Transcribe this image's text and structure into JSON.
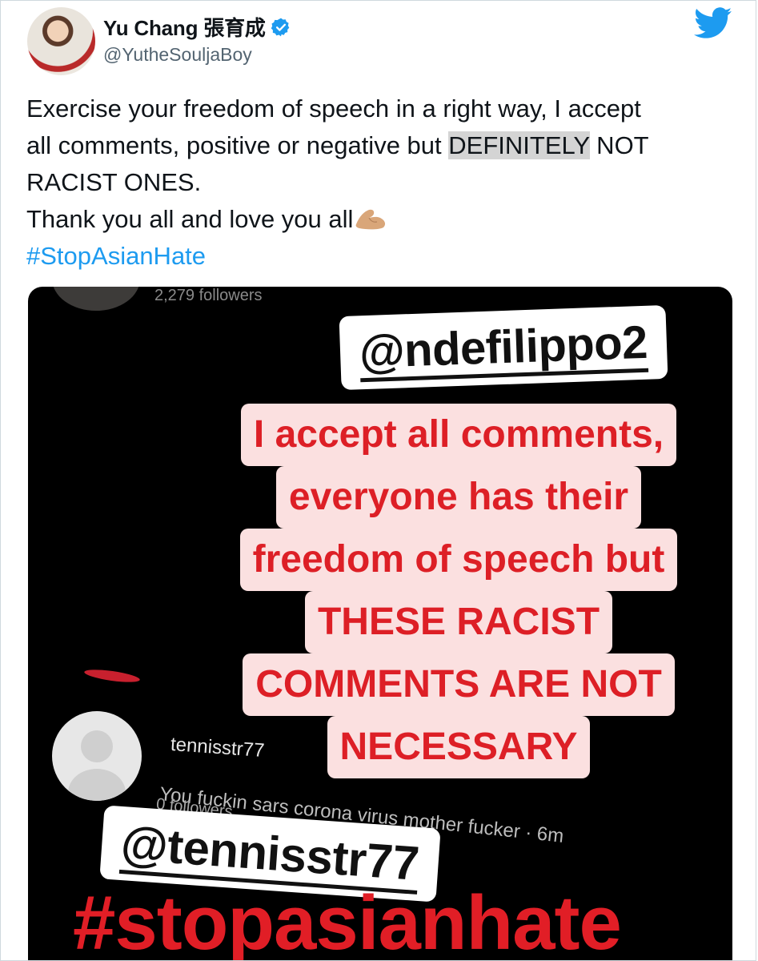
{
  "author": {
    "display_name": "Yu Chang 張育成",
    "handle": "@YutheSouljaBoy",
    "verified_icon": "verified-badge-icon",
    "avatar_icon": "profile-photo"
  },
  "logo_icon": "twitter-bird-icon",
  "tweet": {
    "line1": "Exercise your freedom of speech in a right way, I accept",
    "line2_pre": "all comments, positive or negative but ",
    "line2_highlight": "DEFINITELY",
    "line2_post": " NOT",
    "line3": "RACIST ONES.",
    "line4": "Thank you all and love you all",
    "emoji": "flexed-biceps-emoji",
    "hashtag": "#StopAsianHate"
  },
  "media": {
    "top_followers": "2,279 followers",
    "mention_top": "@ndefilippo2",
    "pink_lines": [
      "I accept all comments,",
      "everyone has their",
      "freedom of speech but",
      "THESE RACIST",
      "COMMENTS ARE NOT",
      "NECESSARY"
    ],
    "comment_user": "tennisstr77",
    "comment_text": "You fuckin sars corona virus mother fucker · 6m",
    "comment_followers": "0 followers",
    "mention_bottom": "@tennisstr77",
    "hashtag_big": "#stopasianhate"
  }
}
